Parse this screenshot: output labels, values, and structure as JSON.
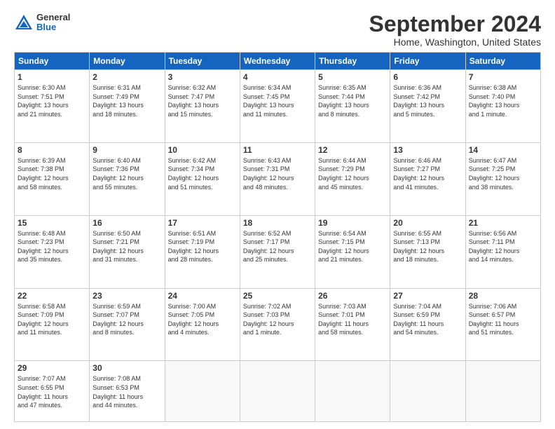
{
  "header": {
    "logo": {
      "general": "General",
      "blue": "Blue"
    },
    "title": "September 2024",
    "location": "Home, Washington, United States"
  },
  "weekdays": [
    "Sunday",
    "Monday",
    "Tuesday",
    "Wednesday",
    "Thursday",
    "Friday",
    "Saturday"
  ],
  "weeks": [
    [
      {
        "day": "1",
        "info": "Sunrise: 6:30 AM\nSunset: 7:51 PM\nDaylight: 13 hours\nand 21 minutes."
      },
      {
        "day": "2",
        "info": "Sunrise: 6:31 AM\nSunset: 7:49 PM\nDaylight: 13 hours\nand 18 minutes."
      },
      {
        "day": "3",
        "info": "Sunrise: 6:32 AM\nSunset: 7:47 PM\nDaylight: 13 hours\nand 15 minutes."
      },
      {
        "day": "4",
        "info": "Sunrise: 6:34 AM\nSunset: 7:45 PM\nDaylight: 13 hours\nand 11 minutes."
      },
      {
        "day": "5",
        "info": "Sunrise: 6:35 AM\nSunset: 7:44 PM\nDaylight: 13 hours\nand 8 minutes."
      },
      {
        "day": "6",
        "info": "Sunrise: 6:36 AM\nSunset: 7:42 PM\nDaylight: 13 hours\nand 5 minutes."
      },
      {
        "day": "7",
        "info": "Sunrise: 6:38 AM\nSunset: 7:40 PM\nDaylight: 13 hours\nand 1 minute."
      }
    ],
    [
      {
        "day": "8",
        "info": "Sunrise: 6:39 AM\nSunset: 7:38 PM\nDaylight: 12 hours\nand 58 minutes."
      },
      {
        "day": "9",
        "info": "Sunrise: 6:40 AM\nSunset: 7:36 PM\nDaylight: 12 hours\nand 55 minutes."
      },
      {
        "day": "10",
        "info": "Sunrise: 6:42 AM\nSunset: 7:34 PM\nDaylight: 12 hours\nand 51 minutes."
      },
      {
        "day": "11",
        "info": "Sunrise: 6:43 AM\nSunset: 7:31 PM\nDaylight: 12 hours\nand 48 minutes."
      },
      {
        "day": "12",
        "info": "Sunrise: 6:44 AM\nSunset: 7:29 PM\nDaylight: 12 hours\nand 45 minutes."
      },
      {
        "day": "13",
        "info": "Sunrise: 6:46 AM\nSunset: 7:27 PM\nDaylight: 12 hours\nand 41 minutes."
      },
      {
        "day": "14",
        "info": "Sunrise: 6:47 AM\nSunset: 7:25 PM\nDaylight: 12 hours\nand 38 minutes."
      }
    ],
    [
      {
        "day": "15",
        "info": "Sunrise: 6:48 AM\nSunset: 7:23 PM\nDaylight: 12 hours\nand 35 minutes."
      },
      {
        "day": "16",
        "info": "Sunrise: 6:50 AM\nSunset: 7:21 PM\nDaylight: 12 hours\nand 31 minutes."
      },
      {
        "day": "17",
        "info": "Sunrise: 6:51 AM\nSunset: 7:19 PM\nDaylight: 12 hours\nand 28 minutes."
      },
      {
        "day": "18",
        "info": "Sunrise: 6:52 AM\nSunset: 7:17 PM\nDaylight: 12 hours\nand 25 minutes."
      },
      {
        "day": "19",
        "info": "Sunrise: 6:54 AM\nSunset: 7:15 PM\nDaylight: 12 hours\nand 21 minutes."
      },
      {
        "day": "20",
        "info": "Sunrise: 6:55 AM\nSunset: 7:13 PM\nDaylight: 12 hours\nand 18 minutes."
      },
      {
        "day": "21",
        "info": "Sunrise: 6:56 AM\nSunset: 7:11 PM\nDaylight: 12 hours\nand 14 minutes."
      }
    ],
    [
      {
        "day": "22",
        "info": "Sunrise: 6:58 AM\nSunset: 7:09 PM\nDaylight: 12 hours\nand 11 minutes."
      },
      {
        "day": "23",
        "info": "Sunrise: 6:59 AM\nSunset: 7:07 PM\nDaylight: 12 hours\nand 8 minutes."
      },
      {
        "day": "24",
        "info": "Sunrise: 7:00 AM\nSunset: 7:05 PM\nDaylight: 12 hours\nand 4 minutes."
      },
      {
        "day": "25",
        "info": "Sunrise: 7:02 AM\nSunset: 7:03 PM\nDaylight: 12 hours\nand 1 minute."
      },
      {
        "day": "26",
        "info": "Sunrise: 7:03 AM\nSunset: 7:01 PM\nDaylight: 11 hours\nand 58 minutes."
      },
      {
        "day": "27",
        "info": "Sunrise: 7:04 AM\nSunset: 6:59 PM\nDaylight: 11 hours\nand 54 minutes."
      },
      {
        "day": "28",
        "info": "Sunrise: 7:06 AM\nSunset: 6:57 PM\nDaylight: 11 hours\nand 51 minutes."
      }
    ],
    [
      {
        "day": "29",
        "info": "Sunrise: 7:07 AM\nSunset: 6:55 PM\nDaylight: 11 hours\nand 47 minutes."
      },
      {
        "day": "30",
        "info": "Sunrise: 7:08 AM\nSunset: 6:53 PM\nDaylight: 11 hours\nand 44 minutes."
      },
      {
        "day": "",
        "info": ""
      },
      {
        "day": "",
        "info": ""
      },
      {
        "day": "",
        "info": ""
      },
      {
        "day": "",
        "info": ""
      },
      {
        "day": "",
        "info": ""
      }
    ]
  ]
}
